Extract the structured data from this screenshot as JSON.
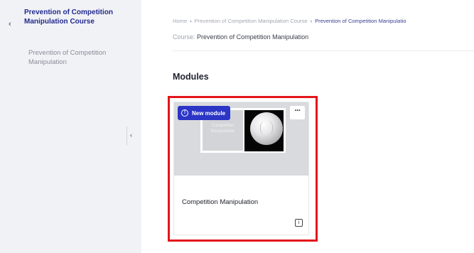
{
  "sidebar": {
    "back_icon": "‹",
    "course_title": "Prevention of Competition Manipulation Course",
    "items": [
      {
        "label": "Prevention of Competition Manipulation"
      }
    ],
    "collapse_icon": "‹"
  },
  "breadcrumb": {
    "items": [
      {
        "label": "Home"
      },
      {
        "label": "Prevention of Competition Manipulation Course"
      },
      {
        "label": "Prevention of Competition Manipulatio"
      }
    ],
    "separator": "›"
  },
  "course_line": {
    "prefix": "Course:",
    "value": "Prevention of Competition Manipulation"
  },
  "modules": {
    "heading": "Modules",
    "cards": [
      {
        "badge_icon": "!",
        "badge_label": "New module",
        "more_label": "···",
        "thumb_text": "Competition Manipulation",
        "title": "Competition Manipulation",
        "info_icon": "i"
      }
    ]
  },
  "colors": {
    "brand": "#2b35c6",
    "highlight": "#e3151a",
    "sidebar_bg": "#f1f2f5"
  }
}
